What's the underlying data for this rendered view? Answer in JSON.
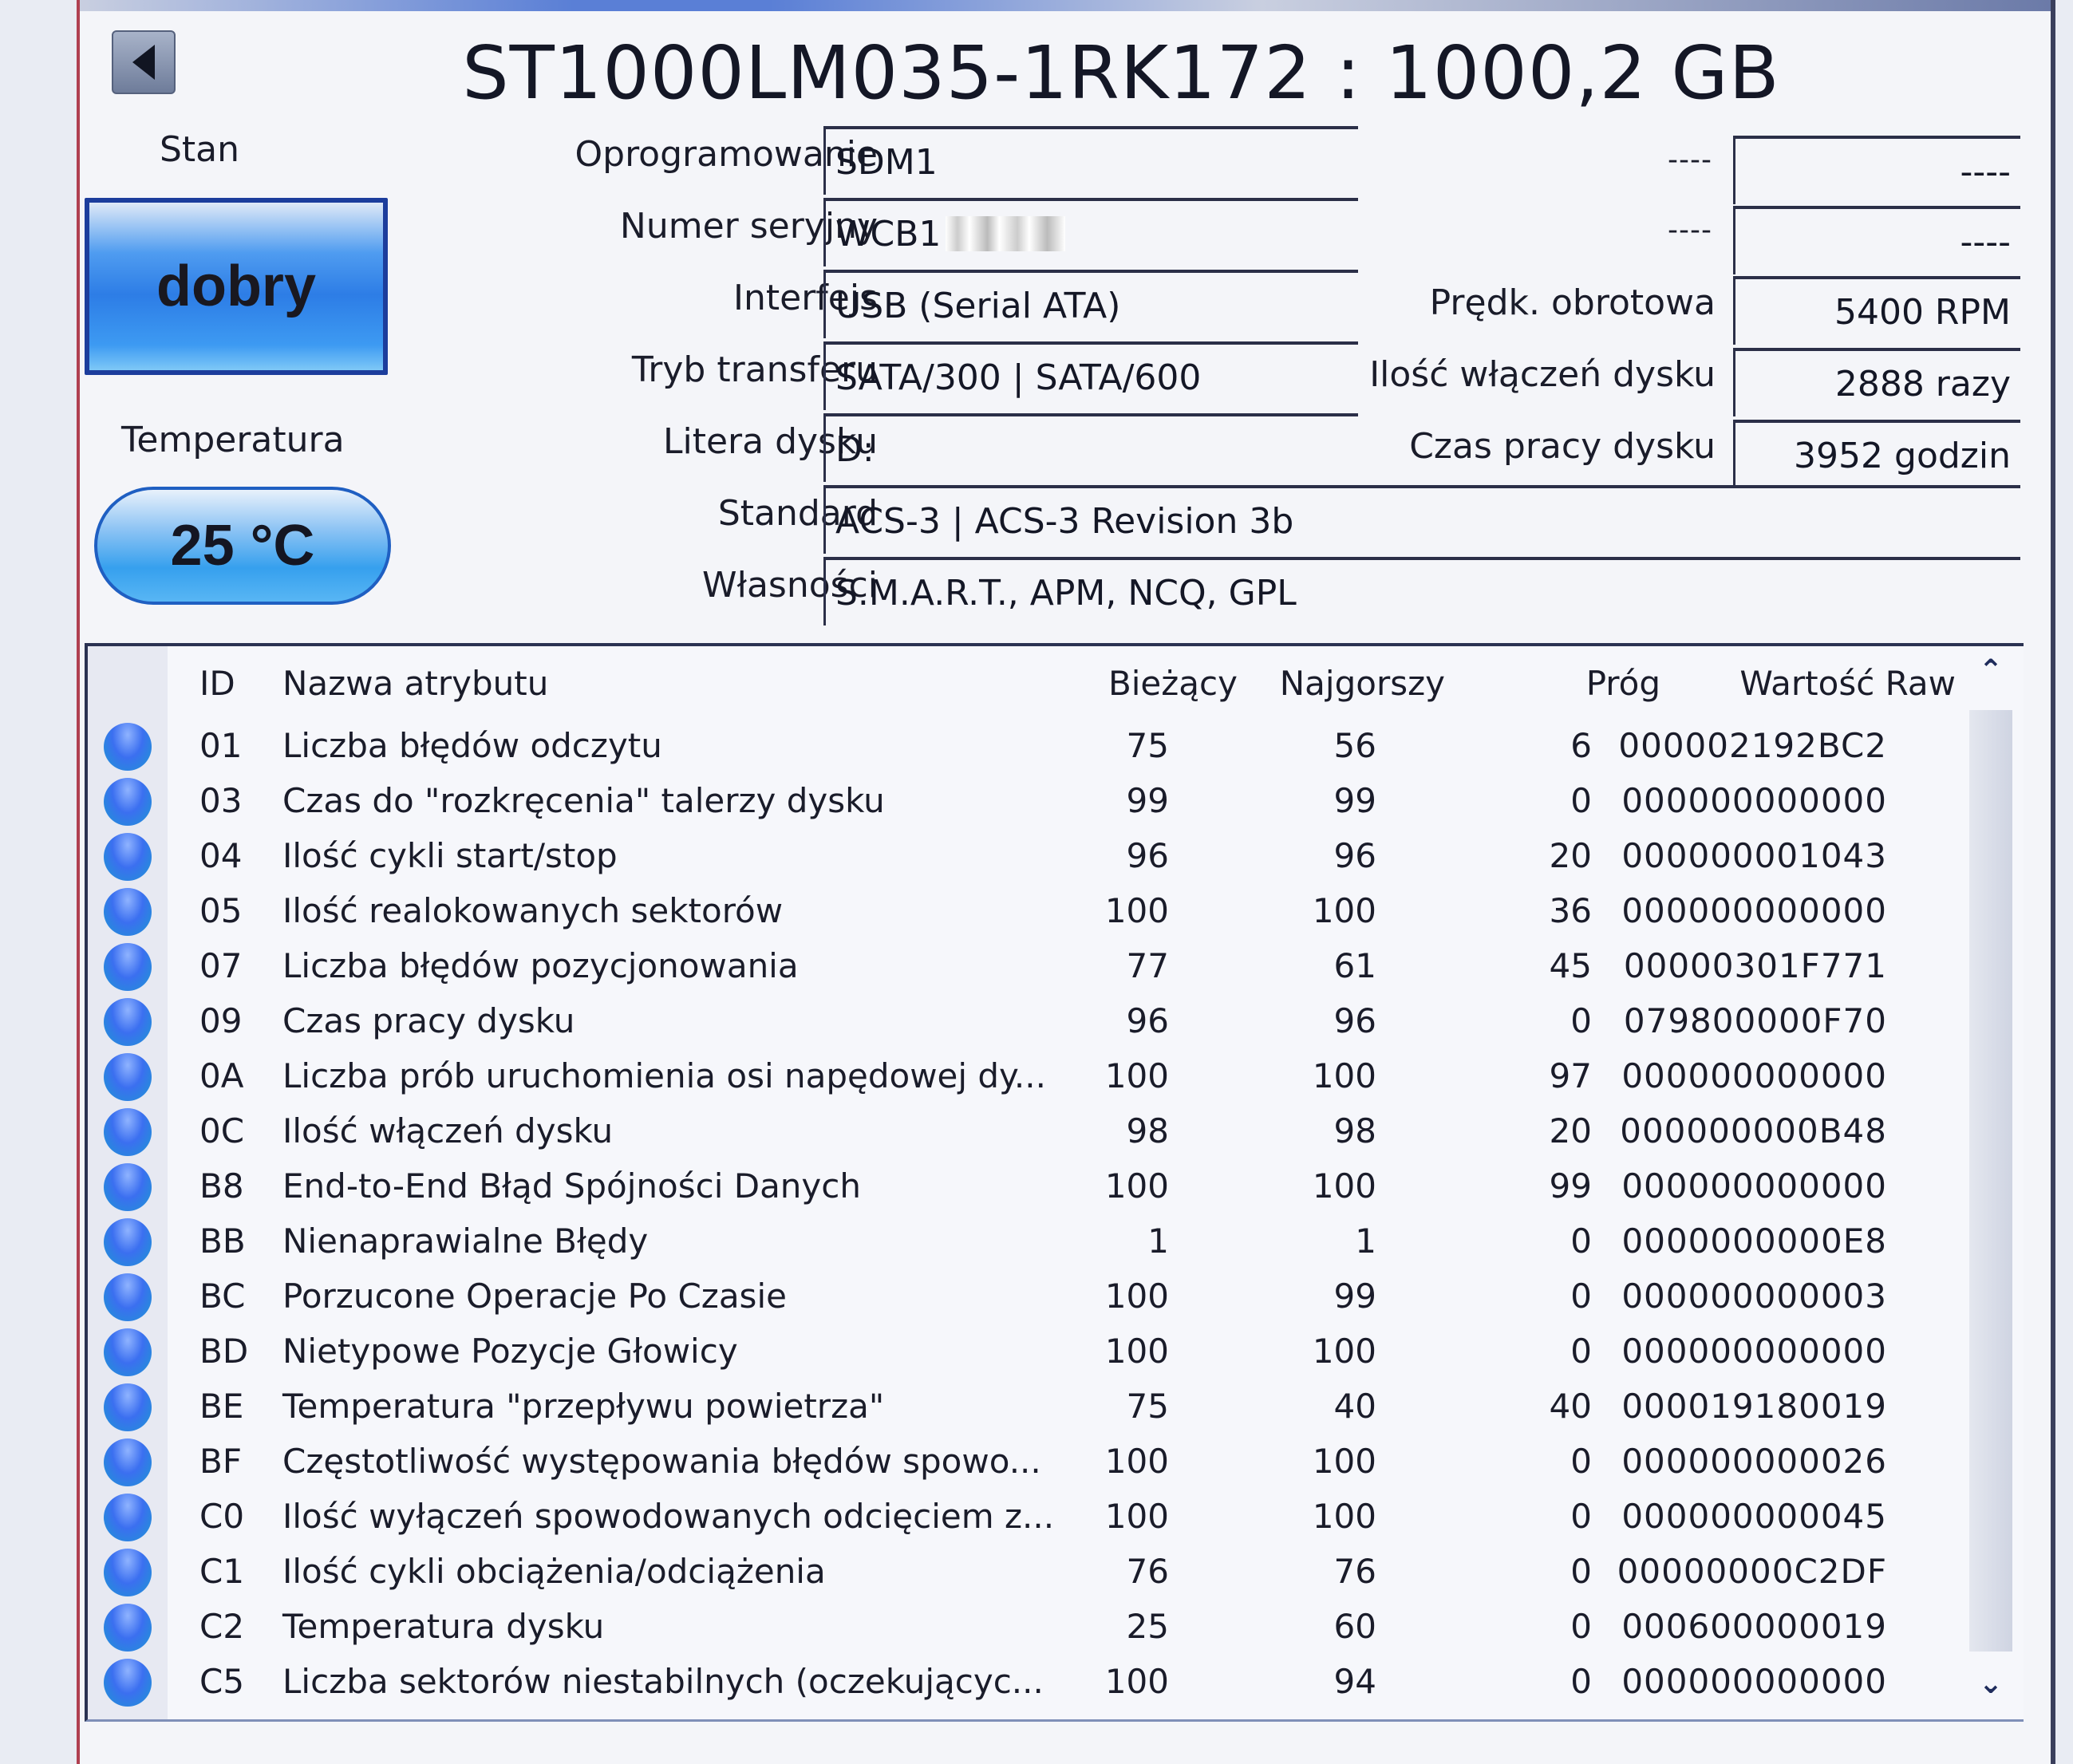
{
  "header": {
    "title": "ST1000LM035-1RK172 : 1000,2 GB",
    "back_icon": "triangle-left-icon"
  },
  "status": {
    "label": "Stan",
    "value": "dobry",
    "color": "#2d7de6"
  },
  "temperature": {
    "label": "Temperatura",
    "value": "25 °C"
  },
  "info_left": [
    {
      "label": "Oprogramowanie",
      "value": "SDM1"
    },
    {
      "label": "Numer seryjny",
      "value": "WCB1"
    },
    {
      "label": "Interfejs",
      "value": "USB (Serial ATA)"
    },
    {
      "label": "Tryb transferu",
      "value": "SATA/300 | SATA/600"
    },
    {
      "label": "Litera dysku",
      "value": "D:"
    }
  ],
  "info_wide": [
    {
      "label": "Standard",
      "value": "ACS-3 | ACS-3 Revision 3b"
    },
    {
      "label": "Własności",
      "value": "S.M.A.R.T., APM, NCQ, GPL"
    }
  ],
  "info_right": [
    {
      "label": "----",
      "value": "----"
    },
    {
      "label": "----",
      "value": "----"
    },
    {
      "label": "Prędk. obrotowa",
      "value": "5400 RPM"
    },
    {
      "label": "Ilość włączeń dysku",
      "value": "2888 razy"
    },
    {
      "label": "Czas pracy dysku",
      "value": "3952 godzin"
    }
  ],
  "smart_table": {
    "columns": {
      "id": "ID",
      "name": "Nazwa atrybutu",
      "current": "Bieżący",
      "worst": "Najgorszy",
      "threshold": "Próg",
      "raw": "Wartość Raw"
    },
    "scroll_up_icon": "chevron-up-icon",
    "scroll_down_icon": "chevron-down-icon",
    "rows": [
      {
        "id": "01",
        "name": "Liczba błędów odczytu",
        "current": "75",
        "worst": "56",
        "threshold": "6",
        "raw": "000002192BC2"
      },
      {
        "id": "03",
        "name": "Czas do \"rozkręcenia\" talerzy dysku",
        "current": "99",
        "worst": "99",
        "threshold": "0",
        "raw": "000000000000"
      },
      {
        "id": "04",
        "name": "Ilość cykli start/stop",
        "current": "96",
        "worst": "96",
        "threshold": "20",
        "raw": "000000001043"
      },
      {
        "id": "05",
        "name": "Ilość realokowanych sektorów",
        "current": "100",
        "worst": "100",
        "threshold": "36",
        "raw": "000000000000"
      },
      {
        "id": "07",
        "name": "Liczba błędów pozycjonowania",
        "current": "77",
        "worst": "61",
        "threshold": "45",
        "raw": "00000301F771"
      },
      {
        "id": "09",
        "name": "Czas pracy dysku",
        "current": "96",
        "worst": "96",
        "threshold": "0",
        "raw": "079800000F70"
      },
      {
        "id": "0A",
        "name": "Liczba prób uruchomienia osi napędowej dy...",
        "current": "100",
        "worst": "100",
        "threshold": "97",
        "raw": "000000000000"
      },
      {
        "id": "0C",
        "name": "Ilość włączeń dysku",
        "current": "98",
        "worst": "98",
        "threshold": "20",
        "raw": "000000000B48"
      },
      {
        "id": "B8",
        "name": "End-to-End Błąd Spójności Danych",
        "current": "100",
        "worst": "100",
        "threshold": "99",
        "raw": "000000000000"
      },
      {
        "id": "BB",
        "name": "Nienaprawialne Błędy",
        "current": "1",
        "worst": "1",
        "threshold": "0",
        "raw": "0000000000E8"
      },
      {
        "id": "BC",
        "name": "Porzucone Operacje Po Czasie",
        "current": "100",
        "worst": "99",
        "threshold": "0",
        "raw": "000000000003"
      },
      {
        "id": "BD",
        "name": "Nietypowe Pozycje Głowicy",
        "current": "100",
        "worst": "100",
        "threshold": "0",
        "raw": "000000000000"
      },
      {
        "id": "BE",
        "name": "Temperatura \"przepływu powietrza\"",
        "current": "75",
        "worst": "40",
        "threshold": "40",
        "raw": "000019180019"
      },
      {
        "id": "BF",
        "name": "Częstotliwość występowania błędów spowo...",
        "current": "100",
        "worst": "100",
        "threshold": "0",
        "raw": "000000000026"
      },
      {
        "id": "C0",
        "name": "Ilość wyłączeń spowodowanych odcięciem z...",
        "current": "100",
        "worst": "100",
        "threshold": "0",
        "raw": "000000000045"
      },
      {
        "id": "C1",
        "name": "Ilość cykli obciążenia/odciążenia",
        "current": "76",
        "worst": "76",
        "threshold": "0",
        "raw": "00000000C2DF"
      },
      {
        "id": "C2",
        "name": "Temperatura dysku",
        "current": "25",
        "worst": "60",
        "threshold": "0",
        "raw": "000600000019"
      },
      {
        "id": "C5",
        "name": "Liczba sektorów niestabilnych (oczekującyc...",
        "current": "100",
        "worst": "94",
        "threshold": "0",
        "raw": "000000000000"
      }
    ]
  }
}
